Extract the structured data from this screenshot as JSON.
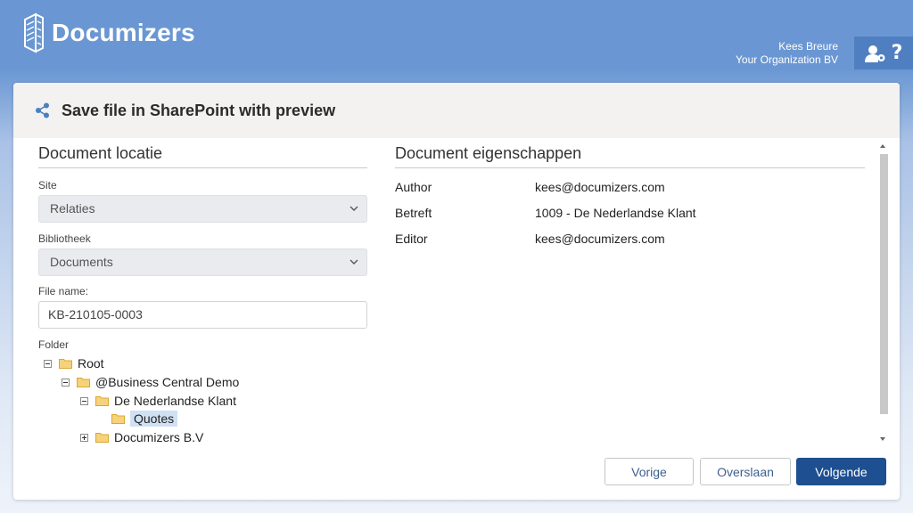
{
  "app": {
    "brand": "Documizers",
    "user_name": "Kees Breure",
    "organization": "Your Organization BV",
    "help": "?"
  },
  "dialog": {
    "title": "Save file in SharePoint with preview",
    "location": {
      "heading": "Document locatie",
      "site_label": "Site",
      "site_value": "Relaties",
      "library_label": "Bibliotheek",
      "library_value": "Documents",
      "filename_label": "File name:",
      "filename_value": "KB-210105-0003",
      "folder_label": "Folder",
      "tree": [
        "Root",
        "@Business Central Demo",
        "De Nederlandse Klant",
        "Quotes",
        "Documizers B.V"
      ]
    },
    "properties": {
      "heading": "Document eigenschappen",
      "rows": [
        {
          "key": "Author",
          "value": "kees@documizers.com"
        },
        {
          "key": "Betreft",
          "value": "1009 - De Nederlandse Klant"
        },
        {
          "key": "Editor",
          "value": "kees@documizers.com"
        }
      ]
    },
    "buttons": {
      "previous": "Vorige",
      "skip": "Overslaan",
      "next": "Volgende"
    }
  },
  "colors": {
    "header": "#6a97d3",
    "primary_button": "#1e4f91",
    "selection": "#cfe1f3",
    "folder": "#f2c45a"
  }
}
